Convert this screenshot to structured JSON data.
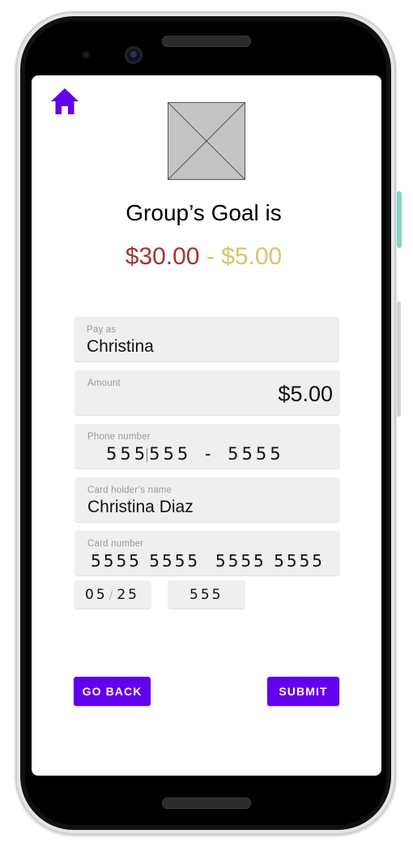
{
  "header": {
    "home_icon": "home-icon",
    "home_icon_color": "#6200ee",
    "image_placeholder": "image-placeholder-icon"
  },
  "goal": {
    "title": "Group’s Goal is",
    "target_amount": "$30.00",
    "separator": " - ",
    "contribution_amount": "$5.00",
    "target_color": "#a83232",
    "contribution_color": "#d7c56a"
  },
  "form": {
    "pay_as": {
      "label": "Pay as",
      "value": "Christina"
    },
    "amount": {
      "label": "Amount",
      "value": "$5.00"
    },
    "phone": {
      "label": "Phone number",
      "area": "555",
      "prefix": "555",
      "separator": "-",
      "line": "5555"
    },
    "card_holder": {
      "label": "Card holder’s name",
      "value": "Christina Diaz"
    },
    "card_number": {
      "label": "Card number",
      "value": "5555 5555  5555 5555"
    },
    "expiry": {
      "month": "05",
      "separator": "/",
      "year": "25"
    },
    "cvv": {
      "value": "555"
    }
  },
  "actions": {
    "back_label": "GO BACK",
    "submit_label": "SUBMIT",
    "accent_color": "#6200ee"
  }
}
